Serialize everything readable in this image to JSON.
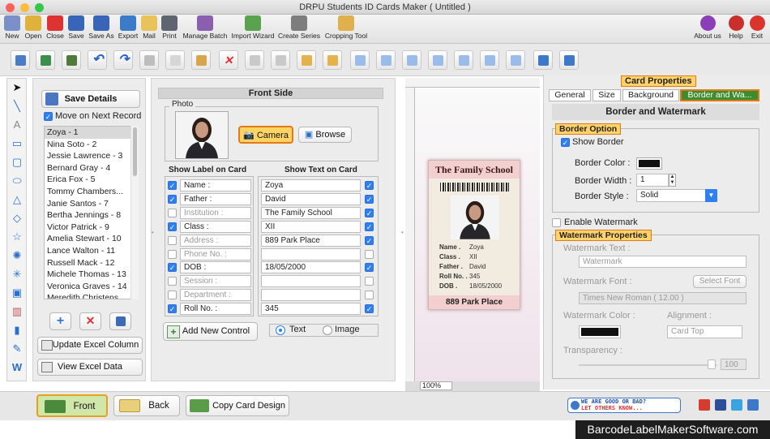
{
  "window": {
    "title": "DRPU Students ID Cards Maker ( Untitled )"
  },
  "toolbar1": {
    "items": [
      {
        "label": "New",
        "icon": "new-icon",
        "color": "#7b8fc9"
      },
      {
        "label": "Open",
        "icon": "open-folder-icon",
        "color": "#e1b23b"
      },
      {
        "label": "Close",
        "icon": "close-file-icon",
        "color": "#d33"
      },
      {
        "label": "Save",
        "icon": "save-icon",
        "color": "#3965b8"
      },
      {
        "label": "Save As",
        "icon": "save-as-icon",
        "color": "#3965b8"
      },
      {
        "label": "Export",
        "icon": "export-icon",
        "color": "#3a7cc8"
      },
      {
        "label": "Mail",
        "icon": "mail-icon",
        "color": "#e9c35a"
      },
      {
        "label": "Print",
        "icon": "print-icon",
        "color": "#5e6470"
      },
      {
        "label": "Manage Batch",
        "icon": "manage-batch-icon",
        "color": "#8a5fb0"
      },
      {
        "label": "Import Wizard",
        "icon": "import-wizard-icon",
        "color": "#5aa24f"
      },
      {
        "label": "Create Series",
        "icon": "create-series-icon",
        "color": "#7d7d7d"
      },
      {
        "label": "Cropping Tool",
        "icon": "cropping-tool-icon",
        "color": "#e0b04f"
      }
    ],
    "right": [
      {
        "label": "About us",
        "icon": "about-icon",
        "color": "#8a3fb9"
      },
      {
        "label": "Help",
        "icon": "help-icon",
        "color": "#c9302c"
      },
      {
        "label": "Exit",
        "icon": "exit-icon",
        "color": "#d9342e"
      }
    ]
  },
  "records": {
    "save_details": "Save Details",
    "move_next": "Move on Next Record",
    "items": [
      "Zoya - 1",
      "Nina Soto - 2",
      "Jessie Lawrence - 3",
      "Bernard Gray - 4",
      "Erica Fox - 5",
      "Tommy Chambers...",
      "Janie Santos - 7",
      "Bertha Jennings - 8",
      "Victor Patrick - 9",
      "Amelia Stewart - 10",
      "Lance Walton - 11",
      "Russell Mack - 12",
      "Michele Thomas - 13",
      "Veronica Graves - 14",
      "Meredith Christens..."
    ],
    "update_excel": "Update Excel Column",
    "view_excel": "View Excel Data"
  },
  "front": {
    "heading": "Front Side",
    "photo_label": "Photo",
    "camera": "Camera",
    "browse": "Browse",
    "show_label_header": "Show Label on Card",
    "show_text_header": "Show Text on Card",
    "rows": [
      {
        "label": "Name :",
        "text": "Zoya",
        "label_on": true,
        "text_on": true
      },
      {
        "label": "Father :",
        "text": "David",
        "label_on": true,
        "text_on": true
      },
      {
        "label": "Institution :",
        "text": "The Family School",
        "label_on": false,
        "text_on": true
      },
      {
        "label": "Class :",
        "text": "XII",
        "label_on": true,
        "text_on": true
      },
      {
        "label": "Address :",
        "text": "889 Park Place",
        "label_on": false,
        "text_on": true
      },
      {
        "label": "Phone No. :",
        "text": "",
        "label_on": false,
        "text_on": false
      },
      {
        "label": "DOB :",
        "text": "18/05/2000",
        "label_on": true,
        "text_on": true
      },
      {
        "label": "Session :",
        "text": "",
        "label_on": false,
        "text_on": false
      },
      {
        "label": "Department :",
        "text": "",
        "label_on": false,
        "text_on": false
      },
      {
        "label": "Roll No. :",
        "text": "345",
        "label_on": true,
        "text_on": true
      }
    ],
    "add_control": "Add New Control",
    "radio_text": "Text",
    "radio_image": "Image"
  },
  "card": {
    "school": "The Family School",
    "fields": [
      {
        "k": "Name .",
        "v": "Zoya"
      },
      {
        "k": "Class .",
        "v": "XII"
      },
      {
        "k": "Father .",
        "v": "David"
      },
      {
        "k": "Roll No. .",
        "v": "345"
      },
      {
        "k": "DOB .",
        "v": "18/05/2000"
      }
    ],
    "address": "889 Park Place",
    "zoom": "100%"
  },
  "props": {
    "title": "Card Properties",
    "tabs": [
      "General",
      "Size",
      "Background",
      "Border and Wa..."
    ],
    "section": "Border and Watermark",
    "border_option": "Border Option",
    "show_border": "Show Border",
    "border_color": "Border Color :",
    "border_width": "Border Width :",
    "border_width_val": "1",
    "border_style": "Border Style :",
    "border_style_val": "Solid",
    "enable_watermark": "Enable Watermark",
    "wm_props": "Watermark Properties",
    "wm_text": "Watermark Text :",
    "wm_text_val": "Watermark",
    "wm_font": "Watermark Font :",
    "pick_font": "Select Font",
    "wm_font_val": "Times New Roman ( 12.00 )",
    "wm_color": "Watermark Color :",
    "alignment": "Alignment :",
    "align_val": "Card Top",
    "transparency": "Transparency :",
    "transparency_val": "100"
  },
  "bottom": {
    "front": "Front",
    "back": "Back",
    "copy": "Copy Card Design",
    "feedback_line1": "WE ARE GOOD OR BAD?",
    "feedback_line2": "LET OTHERS KNOW..."
  },
  "brand": "BarcodeLabelMakerSoftware.com"
}
